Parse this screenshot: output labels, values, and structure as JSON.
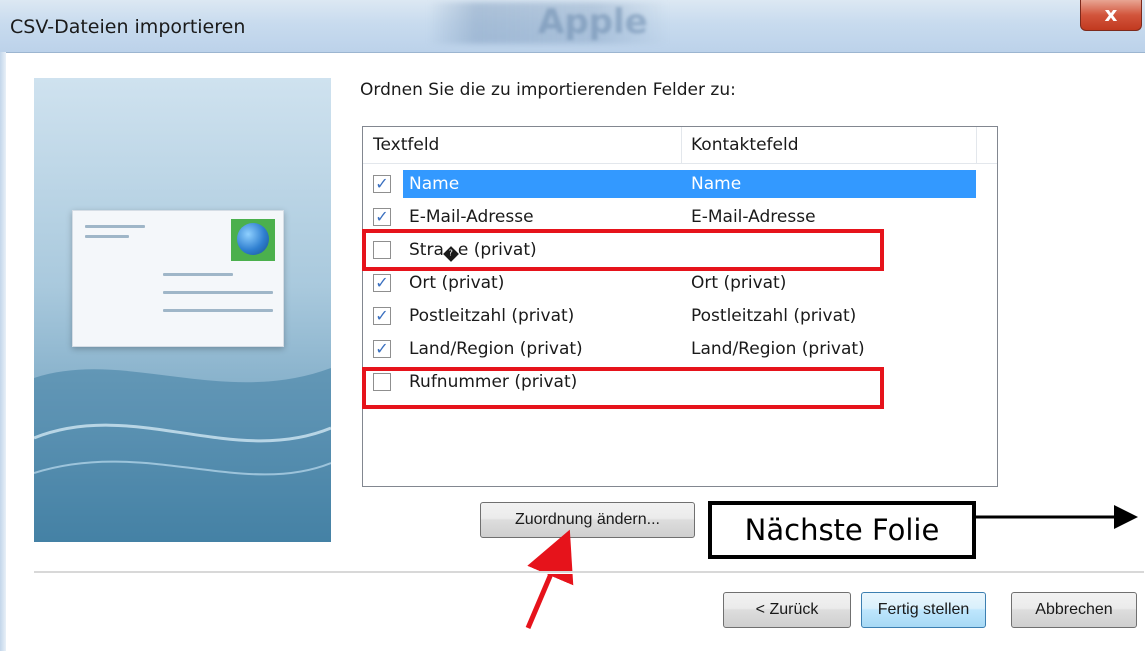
{
  "window": {
    "title": "CSV-Dateien importieren",
    "background_ghost_text": "Apple",
    "close_label": "x"
  },
  "main": {
    "instruction": "Ordnen Sie die zu importierenden Felder zu:",
    "columns": [
      "Textfeld",
      "Kontaktefeld"
    ],
    "rows": [
      {
        "checked": true,
        "text_field": "Name",
        "contact_field": "Name",
        "selected": true
      },
      {
        "checked": true,
        "text_field": "E-Mail-Adresse",
        "contact_field": "E-Mail-Adresse",
        "selected": false
      },
      {
        "checked": false,
        "text_field": "Straï¿½e (privat)",
        "contact_field": "",
        "selected": false
      },
      {
        "checked": true,
        "text_field": "Ort (privat)",
        "contact_field": "Ort (privat)",
        "selected": false
      },
      {
        "checked": true,
        "text_field": "Postleitzahl (privat)",
        "contact_field": "Postleitzahl (privat)",
        "selected": false
      },
      {
        "checked": true,
        "text_field": "Land/Region (privat)",
        "contact_field": "Land/Region (privat)",
        "selected": false
      },
      {
        "checked": false,
        "text_field": "Rufnummer (privat)",
        "contact_field": "",
        "selected": false
      }
    ],
    "change_mapping_button": "Zuordnung ändern..."
  },
  "annotation": {
    "box_label": "Nächste Folie",
    "highlight_color": "#e6131b"
  },
  "footer": {
    "back_button": "< Zurück",
    "finish_button": "Fertig stellen",
    "cancel_button": "Abbrechen"
  },
  "icons": {
    "checkmark": "checkmark-icon",
    "close": "close-icon",
    "envelope": "envelope-icon"
  }
}
